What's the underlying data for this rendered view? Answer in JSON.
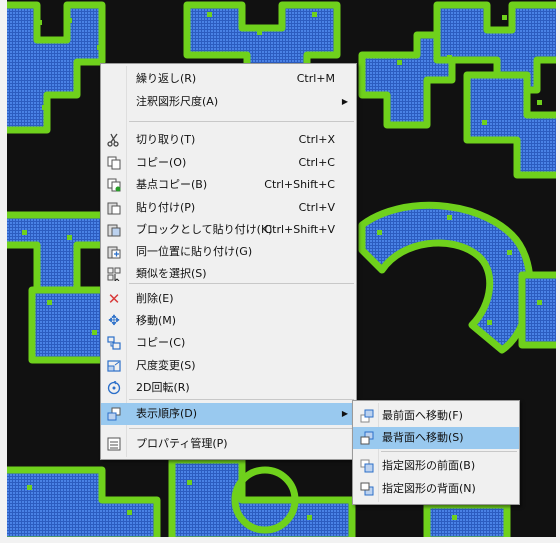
{
  "context_menu": {
    "items": [
      {
        "label": "繰り返し(R)",
        "shortcut": "Ctrl+M",
        "icon": ""
      },
      {
        "label": "注釈図形尺度(A)",
        "shortcut": "",
        "icon": "",
        "submenu": true
      },
      {
        "label": "切り取り(T)",
        "shortcut": "Ctrl+X",
        "icon": "scissors-icon"
      },
      {
        "label": "コピー(O)",
        "shortcut": "Ctrl+C",
        "icon": "copy-icon"
      },
      {
        "label": "基点コピー(B)",
        "shortcut": "Ctrl+Shift+C",
        "icon": "base-point-copy-icon"
      },
      {
        "label": "貼り付け(P)",
        "shortcut": "Ctrl+V",
        "icon": "paste-icon"
      },
      {
        "label": "ブロックとして貼り付け(K)",
        "shortcut": "Ctrl+Shift+V",
        "icon": "paste-as-block-icon"
      },
      {
        "label": "同一位置に貼り付け(G)",
        "shortcut": "",
        "icon": "paste-original-coordinates-icon"
      },
      {
        "label": "類似を選択(S)",
        "shortcut": "",
        "icon": "select-similar-icon"
      },
      {
        "label": "削除(E)",
        "shortcut": "",
        "icon": "delete-icon"
      },
      {
        "label": "移動(M)",
        "shortcut": "",
        "icon": "move-icon"
      },
      {
        "label": "コピー(C)",
        "shortcut": "",
        "icon": "copy-objects-icon"
      },
      {
        "label": "尺度変更(S)",
        "shortcut": "",
        "icon": "scale-icon"
      },
      {
        "label": "2D回転(R)",
        "shortcut": "",
        "icon": "rotate-icon"
      },
      {
        "label": "表示順序(D)",
        "shortcut": "",
        "icon": "draw-order-icon",
        "submenu": true
      },
      {
        "label": "プロパティ管理(P)",
        "shortcut": "",
        "icon": "properties-icon"
      }
    ]
  },
  "draw_order_submenu": {
    "items": [
      {
        "label": "最前面へ移動(F)",
        "icon": "bring-to-front-icon"
      },
      {
        "label": "最背面へ移動(S)",
        "icon": "send-to-back-icon"
      },
      {
        "label": "指定図形の前面(B)",
        "icon": "bring-above-objects-icon"
      },
      {
        "label": "指定図形の背面(N)",
        "icon": "send-under-objects-icon"
      }
    ]
  },
  "colors": {
    "drawing_background": "#111111",
    "letter_fill": "#3b6fd6",
    "letter_outline": "#6fd11c",
    "menu_background": "#f0f0f0",
    "highlight": "#99c9ef",
    "delete_icon": "#d83a3a",
    "icon_blue": "#2b6fc9"
  }
}
